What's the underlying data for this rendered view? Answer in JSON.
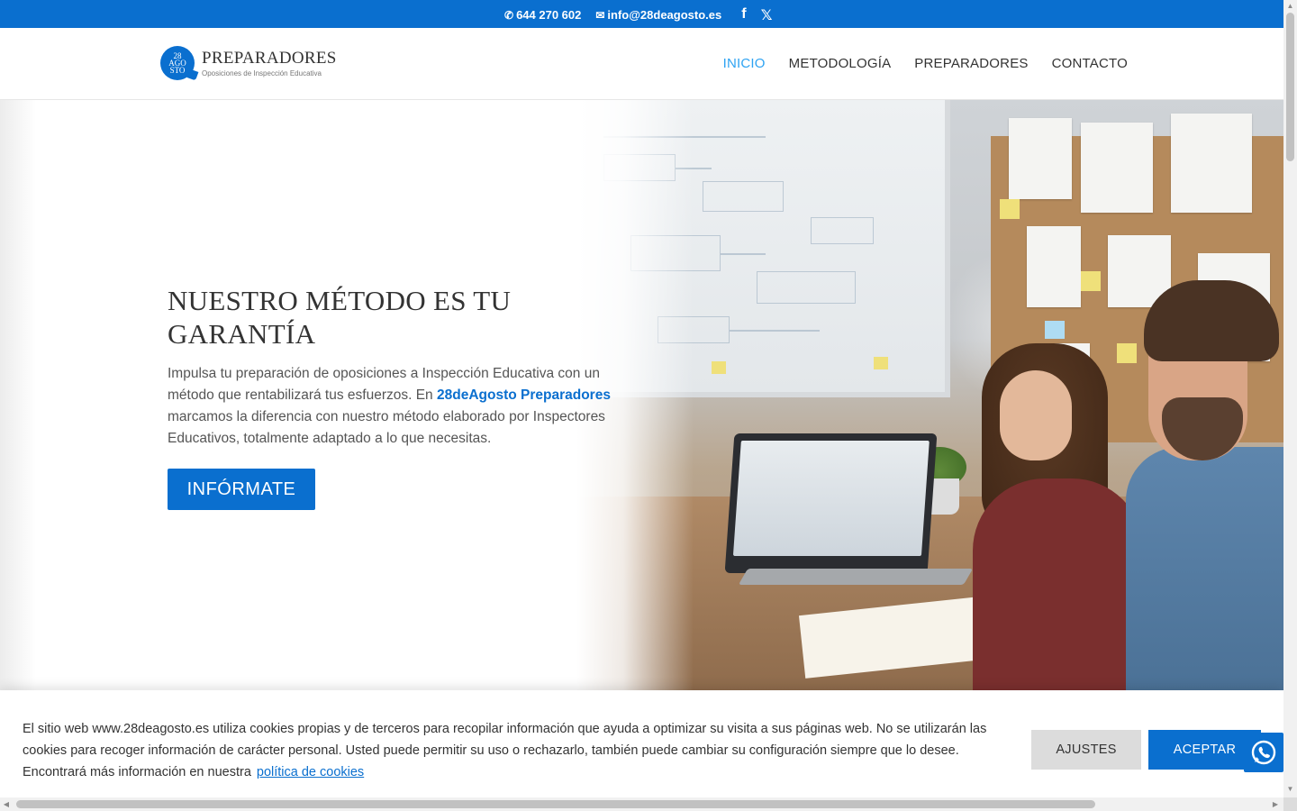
{
  "topbar": {
    "phone": "644 270 602",
    "email": "info@28deagosto.es",
    "icons": [
      "phone-icon",
      "email-icon",
      "facebook-icon",
      "x-twitter-icon"
    ]
  },
  "logo": {
    "badge_lines": [
      "28",
      "AGO",
      "STO"
    ],
    "title": "PREPARADORES",
    "subtitle": "Oposiciones de Inspección Educativa"
  },
  "nav": {
    "items": [
      {
        "label": "INICIO",
        "active": true
      },
      {
        "label": "METODOLOGÍA",
        "active": false
      },
      {
        "label": "PREPARADORES",
        "active": false
      },
      {
        "label": "CONTACTO",
        "active": false
      }
    ]
  },
  "hero": {
    "title": "NUESTRO MÉTODO ES TU GARANTÍA",
    "text_before": "Impulsa tu preparación de oposiciones a Inspección Educativa con un método que rentabilizará  tus esfuerzos. En ",
    "brand": "28deAgosto Preparadores",
    "text_after": " marcamos la diferencia con nuestro método elaborado por Inspectores Educativos, totalmente adaptado a lo que necesitas.",
    "cta": "INFÓRMATE"
  },
  "cookie": {
    "text": "El sitio web www.28deagosto.es utiliza cookies propias y de terceros para recopilar información que ayuda a optimizar su visita a sus páginas web. No se utilizarán las cookies para recoger información de carácter personal. Usted puede permitir su uso o rechazarlo, también puede cambiar su configuración siempre que lo desee. Encontrará más información en nuestra",
    "link": "política de cookies",
    "settings_button": "AJUSTES",
    "accept_button": "ACEPTAR"
  },
  "colors": {
    "brand_blue": "#0a6fcf",
    "nav_active": "#2ea3f2"
  }
}
